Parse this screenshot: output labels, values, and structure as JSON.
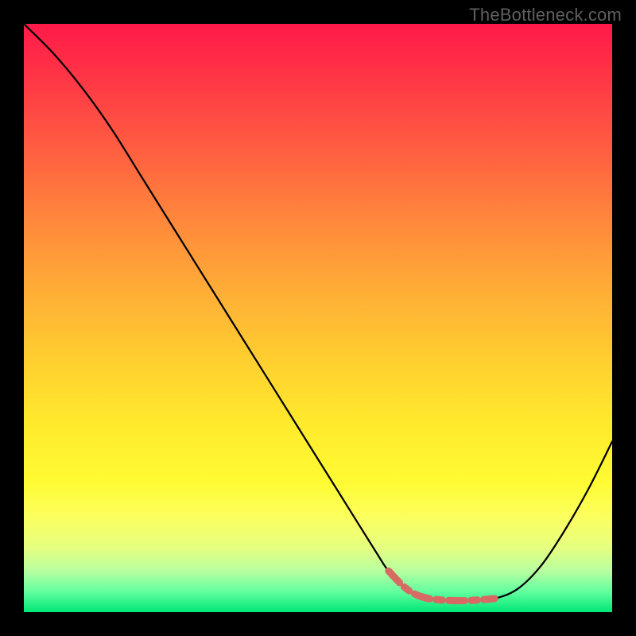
{
  "watermark": "TheBottleneck.com",
  "colors": {
    "background": "#000000",
    "curve": "#000000",
    "highlight": "#d86a64"
  },
  "chart_data": {
    "type": "line",
    "title": "",
    "xlabel": "",
    "ylabel": "",
    "xlim": [
      0,
      100
    ],
    "ylim": [
      0,
      100
    ],
    "series": [
      {
        "name": "bottleneck-curve",
        "x": [
          0,
          5,
          10,
          15,
          20,
          25,
          30,
          35,
          40,
          45,
          50,
          55,
          60,
          62,
          65,
          68,
          72,
          76,
          80,
          84,
          88,
          92,
          96,
          100
        ],
        "y": [
          100,
          95,
          89,
          82,
          74,
          66,
          58,
          50,
          42,
          34,
          26,
          18,
          10,
          7,
          4,
          2.5,
          2,
          2,
          2.3,
          4,
          8,
          14,
          21,
          29
        ]
      }
    ],
    "annotations": [
      {
        "name": "optimal-range",
        "x_start": 62,
        "x_end": 82,
        "style": "thick-dashed-highlight"
      }
    ],
    "background_gradient": {
      "direction": "vertical",
      "stops": [
        {
          "pos": 0.0,
          "color": "#ff1a49"
        },
        {
          "pos": 0.35,
          "color": "#ff8d3b"
        },
        {
          "pos": 0.68,
          "color": "#ffea2c"
        },
        {
          "pos": 0.89,
          "color": "#e6ff80"
        },
        {
          "pos": 1.0,
          "color": "#00e676"
        }
      ]
    }
  }
}
